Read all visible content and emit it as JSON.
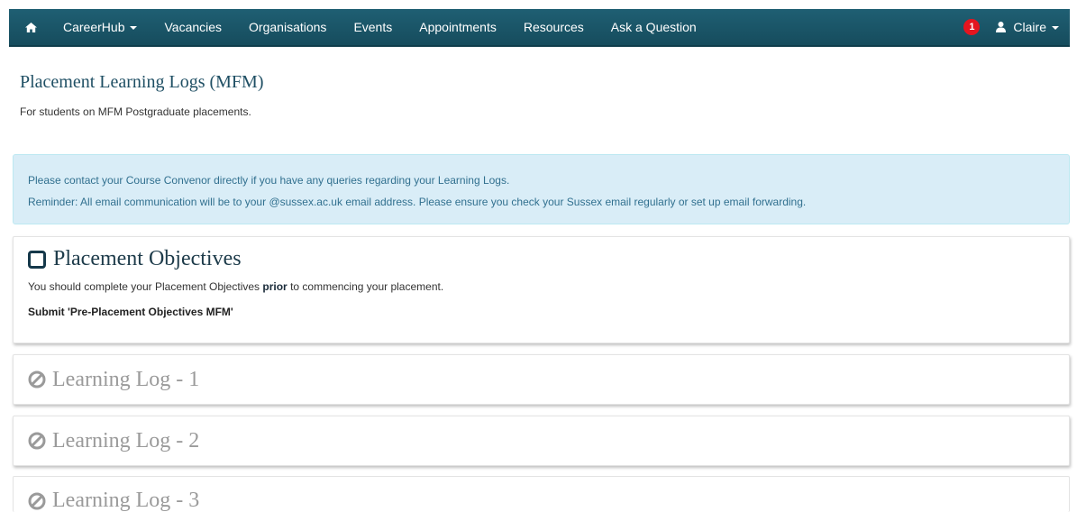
{
  "navbar": {
    "home_icon": "home-icon",
    "items": [
      {
        "label": "CareerHub",
        "dropdown": true
      },
      {
        "label": "Vacancies"
      },
      {
        "label": "Organisations"
      },
      {
        "label": "Events"
      },
      {
        "label": "Appointments"
      },
      {
        "label": "Resources"
      },
      {
        "label": "Ask a Question"
      }
    ],
    "notification_count": "1",
    "user_name": "Claire",
    "colors": {
      "bar": "#1f5f73",
      "badge": "#e4151f"
    }
  },
  "page": {
    "title": "Placement Learning Logs (MFM)",
    "subtitle": "For students on MFM Postgraduate placements."
  },
  "info": {
    "line1": "Please contact your Course Convenor directly if you have any queries regarding your Learning Logs.",
    "line2": "Reminder: All email communication will be to your @sussex.ac.uk email address. Please ensure you check your Sussex email regularly or set up email forwarding.",
    "colors": {
      "background": "#d9edf7",
      "text": "#31708f"
    }
  },
  "objectives": {
    "title": "Placement Objectives",
    "desc_before": "You should complete your Placement Objectives",
    "desc_bold": "prior",
    "desc_after": "to commencing your placement.",
    "submit_text": "Submit 'Pre-Placement Objectives MFM'",
    "icon": "checkbox-icon"
  },
  "logs": [
    {
      "title": "Learning Log - 1",
      "icon": "ban-icon"
    },
    {
      "title": "Learning Log - 2",
      "icon": "ban-icon"
    },
    {
      "title": "Learning Log - 3",
      "icon": "ban-icon"
    }
  ]
}
